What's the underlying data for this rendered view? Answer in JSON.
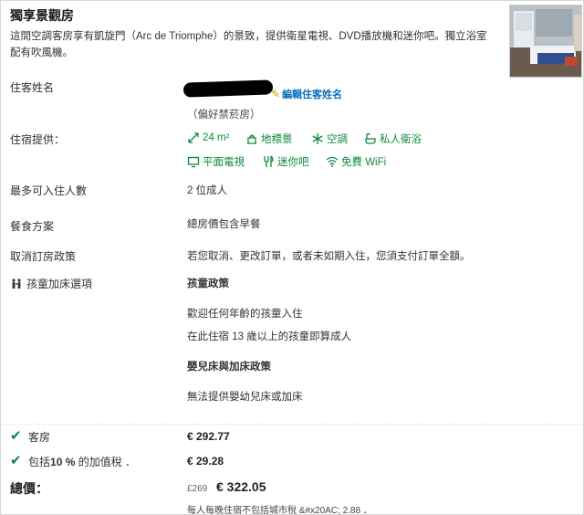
{
  "room": {
    "title": "獨享景觀房",
    "description": "這間空調客房享有凱旋門（Arc de Triomphe）的景致，提供衛星電視、DVD播放機和迷你吧。獨立浴室配有吹風機。"
  },
  "guest": {
    "label": "住客姓名",
    "edit_link": "編輯住客姓名",
    "preference": "（偏好禁菸房）"
  },
  "amenities": {
    "label": "住宿提供：",
    "items": [
      {
        "icon": "room-size-icon",
        "text": "24 m²"
      },
      {
        "icon": "landmark-view-icon",
        "text": "地標景"
      },
      {
        "icon": "air-conditioning-icon",
        "text": "空調"
      },
      {
        "icon": "private-bathroom-icon",
        "text": "私人衛浴"
      },
      {
        "icon": "flat-tv-icon",
        "text": "平面電視"
      },
      {
        "icon": "minibar-icon",
        "text": "迷你吧"
      },
      {
        "icon": "wifi-icon",
        "text": "免費 WiFi"
      }
    ],
    "accent_color": "#0a8a3a"
  },
  "occupancy": {
    "label": "最多可入住人數",
    "value": "2 位成人"
  },
  "meal": {
    "label": "餐食方案",
    "value": "總房價包含早餐"
  },
  "cancel": {
    "label": "取消訂房政策",
    "value": "若您取消、更改訂單，或者未如期入住，您須支付訂單全額。"
  },
  "children": {
    "label": "孩童加床選項",
    "policy_title": "孩童政策",
    "policy_line1": "歡迎任何年齡的孩童入住",
    "policy_line2": "在此住宿 13 歲以上的孩童即算成人",
    "bed_title": "嬰兒床與加床政策",
    "bed_line": "無法提供嬰幼兒床或加床"
  },
  "summary": {
    "room_label": "客房",
    "room_price": "€ 292.77",
    "vat_prefix": "包括",
    "vat_percent": "10 %",
    "vat_suffix": "的加值稅 ．",
    "vat_price": "€ 29.28",
    "total_label": "總價：",
    "old_price": "£269",
    "total_price": "€ 322.05",
    "note": "每人每晚住宿不包括城市稅 &#x20AC; 2.88 ．"
  }
}
